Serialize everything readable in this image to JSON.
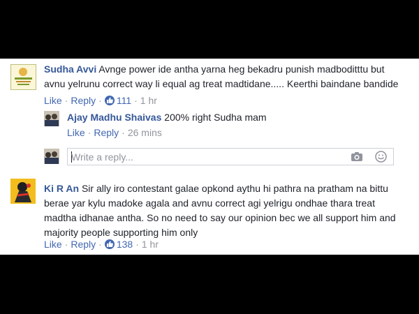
{
  "comments": [
    {
      "author": "Sudha Avvi",
      "text_line1": "Avnge power ide antha yarna heg bekadru punish madboditttu but",
      "text_line2": "avnu yelrunu correct way li equal ag treat madtidane..... Keerthi baindane bandide",
      "like": "Like",
      "reply": "Reply",
      "reactions": "111",
      "time": "1 hr",
      "avatar_colors": {
        "border": "#8a9a3a",
        "fill": "#f2e9b8",
        "accent": "#d9a33a"
      }
    },
    {
      "author": "Ki R An",
      "text_line1": "Sir ally iro contestant galae opkond aythu hi pathra na pratham na bittu",
      "text_line2": "berae yar kylu madoke agala and avnu correct agi yelrigu ondhae thara treat",
      "text_line3": "madtha idhanae antha. So no need to say our opinion bec we all support him and",
      "text_line4": "majority people supporting him only",
      "like": "Like",
      "reply": "Reply",
      "reactions": "138",
      "time": "1 hr"
    }
  ],
  "reply": {
    "author": "Ajay Madhu Shaivas",
    "text": "200% right Sudha mam",
    "like": "Like",
    "reply": "Reply",
    "time": "26 mins"
  },
  "composer": {
    "placeholder": "Write a reply...",
    "icons": [
      "camera-icon",
      "emoji-icon"
    ]
  },
  "colors": {
    "link": "#4267b2",
    "name": "#365899",
    "meta": "#90949c",
    "text": "#1d2129"
  }
}
